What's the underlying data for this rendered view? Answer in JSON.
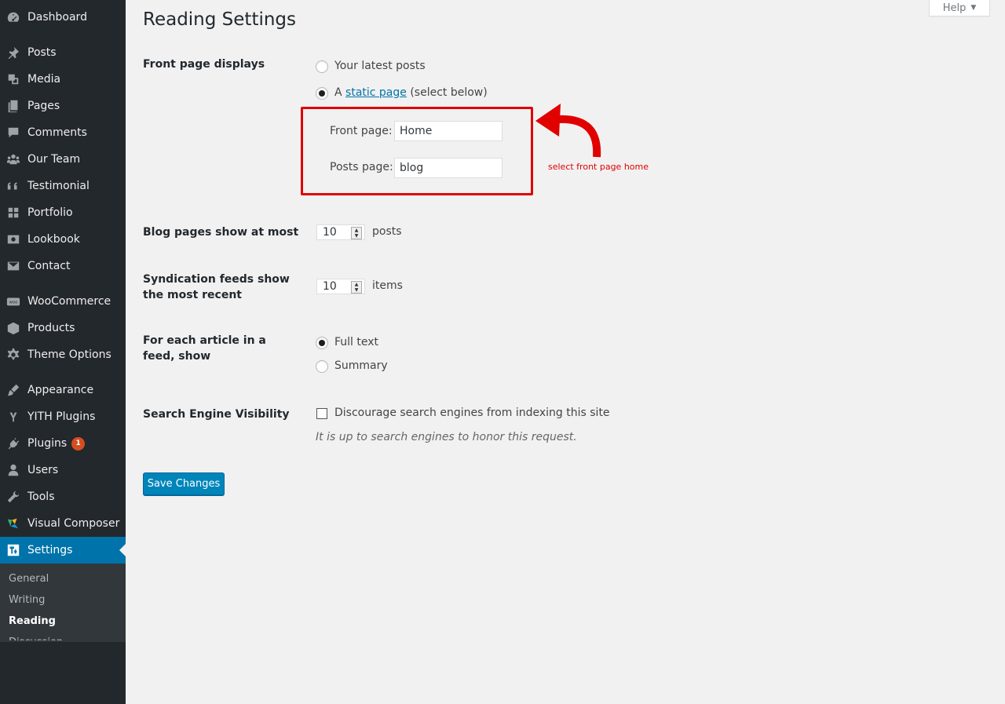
{
  "sidebar": {
    "items": [
      {
        "label": "Dashboard",
        "icon": "dashboard-icon"
      },
      {
        "label": "Posts",
        "icon": "pin-icon"
      },
      {
        "label": "Media",
        "icon": "media-icon"
      },
      {
        "label": "Pages",
        "icon": "pages-icon"
      },
      {
        "label": "Comments",
        "icon": "comment-icon"
      },
      {
        "label": "Our Team",
        "icon": "groups-icon"
      },
      {
        "label": "Testimonial",
        "icon": "quote-icon"
      },
      {
        "label": "Portfolio",
        "icon": "grid-icon"
      },
      {
        "label": "Lookbook",
        "icon": "visibility-icon"
      },
      {
        "label": "Contact",
        "icon": "email-icon"
      },
      {
        "label": "WooCommerce",
        "icon": "woo-icon"
      },
      {
        "label": "Products",
        "icon": "box-icon"
      },
      {
        "label": "Theme Options",
        "icon": "gear-icon"
      },
      {
        "label": "Appearance",
        "icon": "brush-icon"
      },
      {
        "label": "YITH Plugins",
        "icon": "yith-icon"
      },
      {
        "label": "Plugins",
        "icon": "plug-icon",
        "badge": "1"
      },
      {
        "label": "Users",
        "icon": "user-icon"
      },
      {
        "label": "Tools",
        "icon": "wrench-icon"
      },
      {
        "label": "Visual Composer",
        "icon": "vc-icon"
      },
      {
        "label": "Settings",
        "icon": "settings-icon"
      }
    ],
    "submenu": [
      "General",
      "Writing",
      "Reading",
      "Discussion"
    ]
  },
  "header": {
    "title": "Reading Settings",
    "help": "Help"
  },
  "front_page": {
    "heading": "Front page displays",
    "opt_latest": "Your latest posts",
    "opt_static_prefix": "A",
    "opt_static_link": "static page",
    "opt_static_suffix": "(select below)",
    "front_label": "Front page:",
    "front_value": "Home",
    "posts_label": "Posts page:",
    "posts_value": "blog"
  },
  "annotation": {
    "text": "select front page home",
    "color": "#e00000"
  },
  "blog_pages": {
    "heading": "Blog pages show at most",
    "value": "10",
    "unit": "posts"
  },
  "syndication": {
    "heading": "Syndication feeds show the most recent",
    "value": "10",
    "unit": "items"
  },
  "feed_article": {
    "heading": "For each article in a feed, show",
    "opt_full": "Full text",
    "opt_summary": "Summary"
  },
  "search_visibility": {
    "heading": "Search Engine Visibility",
    "checkbox_label": "Discourage search engines from indexing this site",
    "description": "It is up to search engines to honor this request."
  },
  "save_label": "Save Changes",
  "colors": {
    "sidebar_bg": "#23282d",
    "accent": "#0073aa",
    "button": "#0085ba"
  }
}
